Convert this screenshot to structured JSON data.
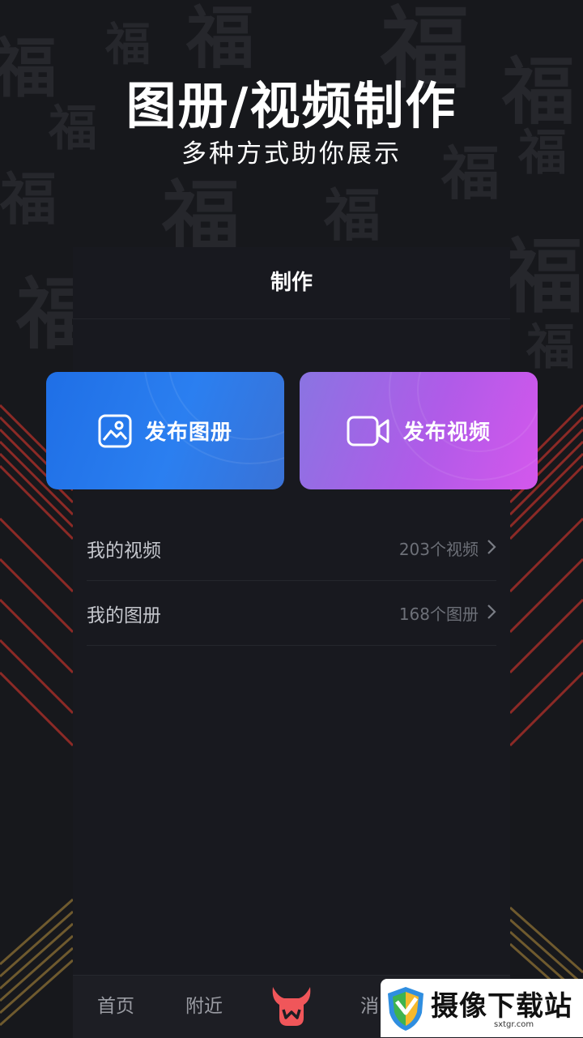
{
  "hero": {
    "title": "图册/视频制作",
    "subtitle": "多种方式助你展示"
  },
  "panel": {
    "title": "制作"
  },
  "cards": {
    "photo_label": "发布图册",
    "video_label": "发布视频"
  },
  "list": [
    {
      "label": "我的视频",
      "count": "203个视频"
    },
    {
      "label": "我的图册",
      "count": "168个图册"
    }
  ],
  "tabbar": {
    "home": "首页",
    "nearby": "附近",
    "messages": "消"
  },
  "watermark": {
    "text": "摄像下载站",
    "url": "sxtgr.com"
  },
  "background": {
    "character": "福"
  },
  "colors": {
    "photo_card": "#2b7ff0",
    "video_card": "#c05aea",
    "center_tab": "#f0565a"
  },
  "icons": [
    "image-icon",
    "video-camera-icon",
    "chevron-right-icon",
    "horns-logo-icon",
    "shield-logo-icon"
  ]
}
